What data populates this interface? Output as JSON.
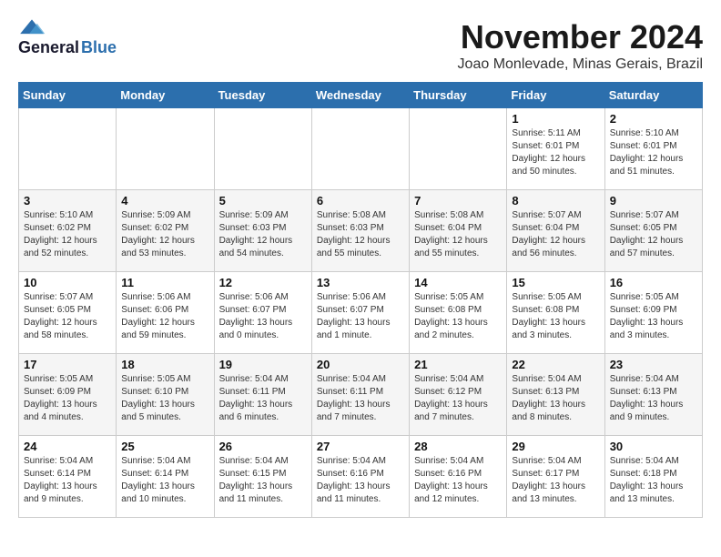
{
  "logo": {
    "general": "General",
    "blue": "Blue"
  },
  "title": {
    "month": "November 2024",
    "location": "Joao Monlevade, Minas Gerais, Brazil"
  },
  "headers": [
    "Sunday",
    "Monday",
    "Tuesday",
    "Wednesday",
    "Thursday",
    "Friday",
    "Saturday"
  ],
  "weeks": [
    [
      {
        "day": "",
        "info": ""
      },
      {
        "day": "",
        "info": ""
      },
      {
        "day": "",
        "info": ""
      },
      {
        "day": "",
        "info": ""
      },
      {
        "day": "",
        "info": ""
      },
      {
        "day": "1",
        "info": "Sunrise: 5:11 AM\nSunset: 6:01 PM\nDaylight: 12 hours and 50 minutes."
      },
      {
        "day": "2",
        "info": "Sunrise: 5:10 AM\nSunset: 6:01 PM\nDaylight: 12 hours and 51 minutes."
      }
    ],
    [
      {
        "day": "3",
        "info": "Sunrise: 5:10 AM\nSunset: 6:02 PM\nDaylight: 12 hours and 52 minutes."
      },
      {
        "day": "4",
        "info": "Sunrise: 5:09 AM\nSunset: 6:02 PM\nDaylight: 12 hours and 53 minutes."
      },
      {
        "day": "5",
        "info": "Sunrise: 5:09 AM\nSunset: 6:03 PM\nDaylight: 12 hours and 54 minutes."
      },
      {
        "day": "6",
        "info": "Sunrise: 5:08 AM\nSunset: 6:03 PM\nDaylight: 12 hours and 55 minutes."
      },
      {
        "day": "7",
        "info": "Sunrise: 5:08 AM\nSunset: 6:04 PM\nDaylight: 12 hours and 55 minutes."
      },
      {
        "day": "8",
        "info": "Sunrise: 5:07 AM\nSunset: 6:04 PM\nDaylight: 12 hours and 56 minutes."
      },
      {
        "day": "9",
        "info": "Sunrise: 5:07 AM\nSunset: 6:05 PM\nDaylight: 12 hours and 57 minutes."
      }
    ],
    [
      {
        "day": "10",
        "info": "Sunrise: 5:07 AM\nSunset: 6:05 PM\nDaylight: 12 hours and 58 minutes."
      },
      {
        "day": "11",
        "info": "Sunrise: 5:06 AM\nSunset: 6:06 PM\nDaylight: 12 hours and 59 minutes."
      },
      {
        "day": "12",
        "info": "Sunrise: 5:06 AM\nSunset: 6:07 PM\nDaylight: 13 hours and 0 minutes."
      },
      {
        "day": "13",
        "info": "Sunrise: 5:06 AM\nSunset: 6:07 PM\nDaylight: 13 hours and 1 minute."
      },
      {
        "day": "14",
        "info": "Sunrise: 5:05 AM\nSunset: 6:08 PM\nDaylight: 13 hours and 2 minutes."
      },
      {
        "day": "15",
        "info": "Sunrise: 5:05 AM\nSunset: 6:08 PM\nDaylight: 13 hours and 3 minutes."
      },
      {
        "day": "16",
        "info": "Sunrise: 5:05 AM\nSunset: 6:09 PM\nDaylight: 13 hours and 3 minutes."
      }
    ],
    [
      {
        "day": "17",
        "info": "Sunrise: 5:05 AM\nSunset: 6:09 PM\nDaylight: 13 hours and 4 minutes."
      },
      {
        "day": "18",
        "info": "Sunrise: 5:05 AM\nSunset: 6:10 PM\nDaylight: 13 hours and 5 minutes."
      },
      {
        "day": "19",
        "info": "Sunrise: 5:04 AM\nSunset: 6:11 PM\nDaylight: 13 hours and 6 minutes."
      },
      {
        "day": "20",
        "info": "Sunrise: 5:04 AM\nSunset: 6:11 PM\nDaylight: 13 hours and 7 minutes."
      },
      {
        "day": "21",
        "info": "Sunrise: 5:04 AM\nSunset: 6:12 PM\nDaylight: 13 hours and 7 minutes."
      },
      {
        "day": "22",
        "info": "Sunrise: 5:04 AM\nSunset: 6:13 PM\nDaylight: 13 hours and 8 minutes."
      },
      {
        "day": "23",
        "info": "Sunrise: 5:04 AM\nSunset: 6:13 PM\nDaylight: 13 hours and 9 minutes."
      }
    ],
    [
      {
        "day": "24",
        "info": "Sunrise: 5:04 AM\nSunset: 6:14 PM\nDaylight: 13 hours and 9 minutes."
      },
      {
        "day": "25",
        "info": "Sunrise: 5:04 AM\nSunset: 6:14 PM\nDaylight: 13 hours and 10 minutes."
      },
      {
        "day": "26",
        "info": "Sunrise: 5:04 AM\nSunset: 6:15 PM\nDaylight: 13 hours and 11 minutes."
      },
      {
        "day": "27",
        "info": "Sunrise: 5:04 AM\nSunset: 6:16 PM\nDaylight: 13 hours and 11 minutes."
      },
      {
        "day": "28",
        "info": "Sunrise: 5:04 AM\nSunset: 6:16 PM\nDaylight: 13 hours and 12 minutes."
      },
      {
        "day": "29",
        "info": "Sunrise: 5:04 AM\nSunset: 6:17 PM\nDaylight: 13 hours and 13 minutes."
      },
      {
        "day": "30",
        "info": "Sunrise: 5:04 AM\nSunset: 6:18 PM\nDaylight: 13 hours and 13 minutes."
      }
    ]
  ]
}
